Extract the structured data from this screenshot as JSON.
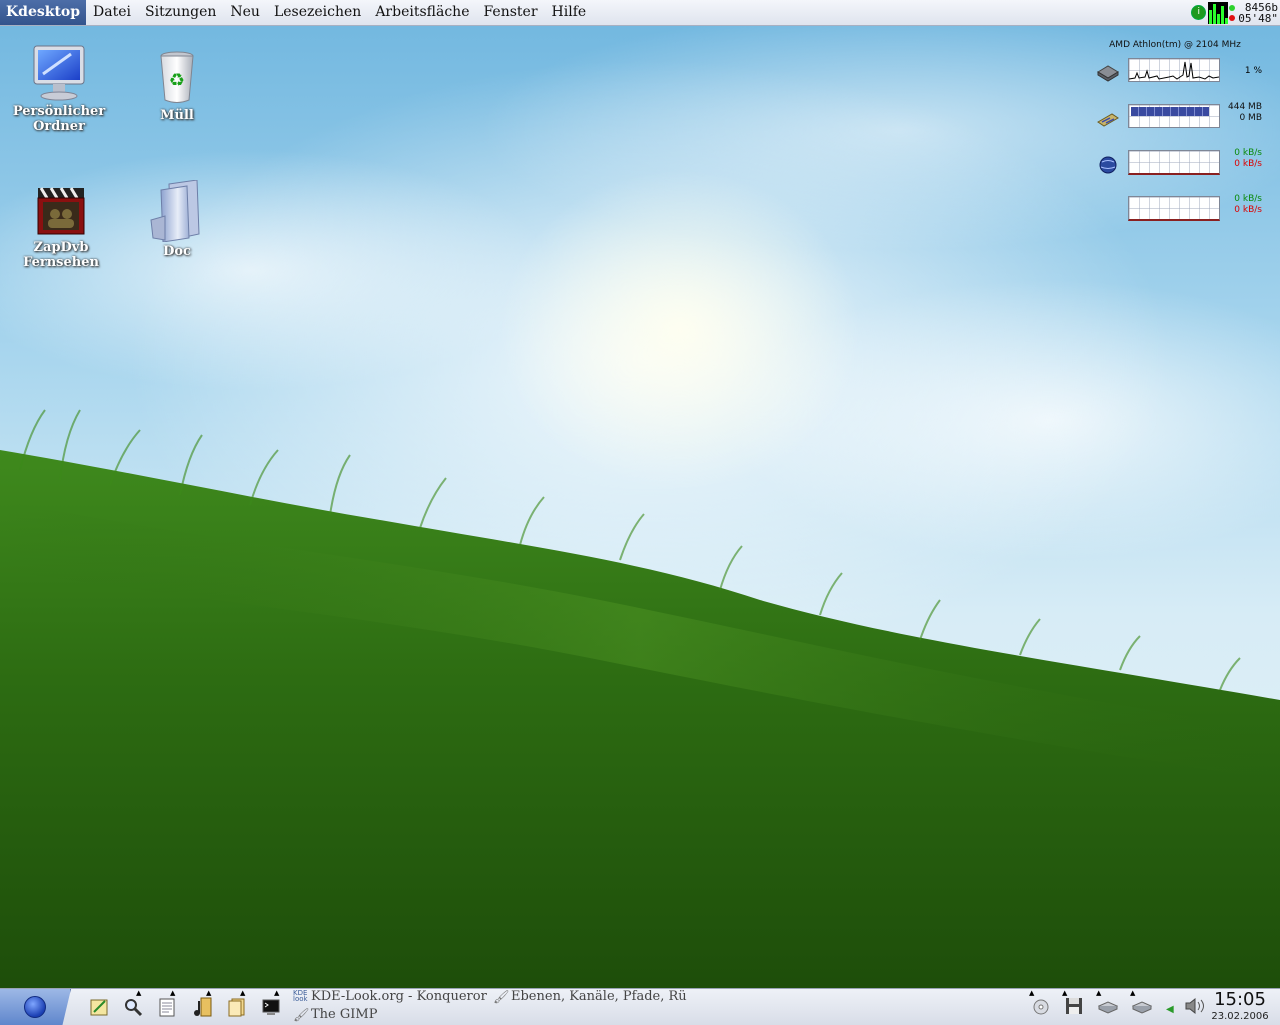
{
  "menubar": {
    "app": "Kdesktop",
    "items": [
      "Datei",
      "Sitzungen",
      "Neu",
      "Lesezeichen",
      "Arbeitsfläche",
      "Fenster",
      "Hilfe"
    ]
  },
  "tray_top": {
    "line1": "8456b",
    "line2": "05'48\"",
    "indicator": "i"
  },
  "desktop_icons": [
    {
      "label1": "Persönlicher",
      "label2": "Ordner",
      "icon": "monitor-icon"
    },
    {
      "label1": "Müll",
      "icon": "trash-icon"
    },
    {
      "label1": "ZapDvb",
      "label2": "Fernsehen",
      "icon": "tv-clapper-icon"
    },
    {
      "label1": "Doc",
      "icon": "folder-icon"
    }
  ],
  "sysmon": {
    "title": "AMD Athlon(tm) @ 2104 MHz",
    "cpu": {
      "value": "1 %"
    },
    "memory": {
      "used": "444 MB",
      "swap": "0 MB"
    },
    "network1": {
      "in": "0 kB/s",
      "out": "0 kB/s"
    },
    "network2": {
      "in": "0 kB/s",
      "out": "0 kB/s"
    }
  },
  "taskbar": {
    "tasks": [
      {
        "label": "KDE-Look.org - Konqueror",
        "icon": "kde-look-icon"
      },
      {
        "label": "Ebenen, Kanäle, Pfade, Rü",
        "icon": "gimp-icon"
      },
      {
        "label": "The GIMP",
        "icon": "gimp-icon"
      }
    ]
  },
  "clock": {
    "time": "15:05",
    "date": "23.02.2006"
  },
  "colors": {
    "menu_highlight": "#3a5c98",
    "grass": "#2f6b13",
    "sky": "#8cc8e8"
  }
}
